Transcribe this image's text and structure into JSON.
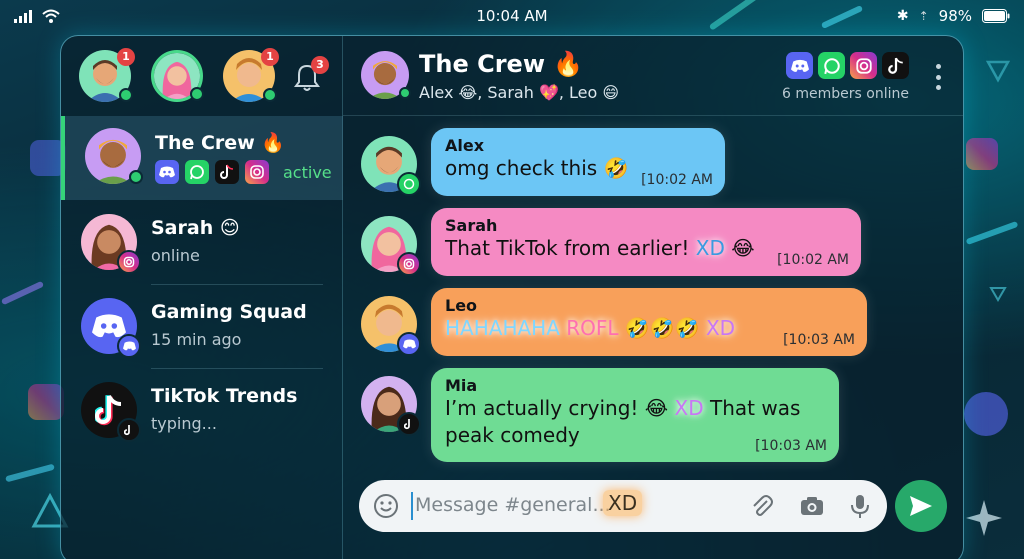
{
  "status_bar": {
    "time": "10:04 AM",
    "battery": "98%"
  },
  "top_badges": [
    "1",
    "1",
    "3"
  ],
  "conversations": [
    {
      "name": "The Crew 🔥",
      "status": "active"
    },
    {
      "name": "Sarah 😊",
      "status": "online"
    },
    {
      "name": "Gaming Squad",
      "status": "15 min ago"
    },
    {
      "name": "TikTok Trends",
      "status": "typing..."
    }
  ],
  "chat": {
    "title": "The Crew 🔥",
    "members": "Alex 😂, Sarah 💖, Leo 😄",
    "online": "6 members online",
    "platforms": [
      "discord-icon",
      "whatsapp-icon",
      "instagram-icon",
      "tiktok-icon"
    ]
  },
  "messages": [
    {
      "sender": "Alex",
      "text": "omg check this 🤣",
      "time": "[10:02 AM",
      "color": "#6cc6f5",
      "platform": "whatsapp-icon"
    },
    {
      "sender": "Sarah",
      "text_a": "That TikTok from earlier! ",
      "xd": "XD",
      "text_b": " 😂",
      "time": "[10:02 AM",
      "color": "#f58ac3",
      "platform": "instagram-icon"
    },
    {
      "sender": "Leo",
      "hahaha": "HAHAHAHA",
      "rofl": "ROFL",
      "text_b": "🤣🤣🤣",
      "xd": "XD",
      "time": "[10:03 AM",
      "color": "#f8a05a",
      "platform": "discord-icon"
    },
    {
      "sender": "Mia",
      "text_a": "I’m actually crying! 😂 ",
      "xd": "XD",
      "text_b": " That was",
      "line2": "peak comedy",
      "time": "[10:03 AM",
      "color": "#6fdc94",
      "platform": "tiktok-icon"
    }
  ],
  "input": {
    "placeholder": "Message #general...",
    "xd": "XD"
  },
  "colors": {
    "accent": "#27a96a",
    "active": "#56e08a",
    "badge": "#e44343"
  }
}
